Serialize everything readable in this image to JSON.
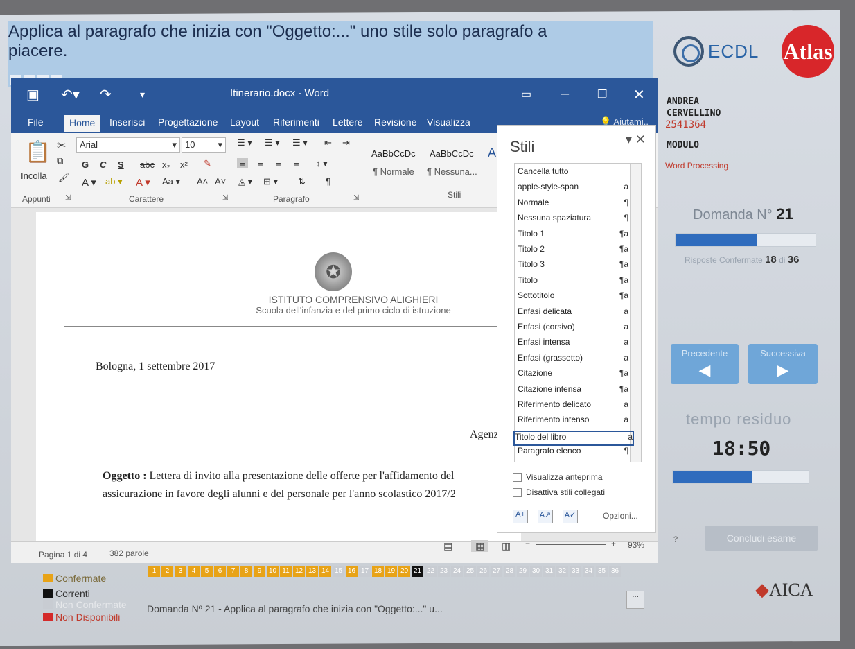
{
  "question": {
    "line1": "Applica al paragrafo che inizia con \"Oggetto:...\" uno stile solo paragrafo a",
    "line2": "piacere."
  },
  "logos": {
    "ecdl": "ECDL",
    "atlas": "Atlas",
    "aica": "AICA"
  },
  "word": {
    "title": "Itinerario.docx - Word",
    "menu": {
      "file": "File",
      "home": "Home",
      "inserisci": "Inserisci",
      "progettazione": "Progettazione",
      "layout": "Layout",
      "riferimenti": "Riferimenti",
      "lettere": "Lettere",
      "revisione": "Revisione",
      "visualizza": "Visualizza",
      "aiutami": "Aiutami.."
    },
    "ribbon": {
      "font": "Arial",
      "size": "10",
      "incolla": "Incolla",
      "style1": "AaBbCcDc",
      "style2": "AaBbCcDc",
      "style3": "A",
      "normale": "¶ Normale",
      "nessuna": "¶ Nessuna...",
      "groups": {
        "appunti": "Appunti",
        "carattere": "Carattere",
        "paragrafo": "Paragrafo",
        "stili": "Stili"
      }
    },
    "document": {
      "school": "ISTITUTO COMPRENSIVO ALIGHIERI",
      "school_sub": "Scuola dell'infanzia e del primo ciclo di istruzione",
      "date": "Bologna, 1 settembre 2017",
      "agenz": "Agenz",
      "oggetto_label": "Oggetto :",
      "oggetto_line1": " Lettera di invito alla presentazione delle offerte per l'affidamento del",
      "oggetto_line2": "assicurazione in favore degli alunni e del personale per l'anno scolastico 2017/2"
    },
    "status": {
      "page": "Pagina 1 di 4",
      "words": "382 parole",
      "zoom": "93%"
    }
  },
  "styles_pane": {
    "title": "Stili",
    "items": [
      {
        "label": "Cancella tutto",
        "sym": ""
      },
      {
        "label": "apple-style-span",
        "sym": "a"
      },
      {
        "label": "Normale",
        "sym": "¶"
      },
      {
        "label": "Nessuna spaziatura",
        "sym": "¶"
      },
      {
        "label": "Titolo 1",
        "sym": "¶a"
      },
      {
        "label": "Titolo 2",
        "sym": "¶a"
      },
      {
        "label": "Titolo 3",
        "sym": "¶a"
      },
      {
        "label": "Titolo",
        "sym": "¶a"
      },
      {
        "label": "Sottotitolo",
        "sym": "¶a"
      },
      {
        "label": "Enfasi delicata",
        "sym": "a"
      },
      {
        "label": "Enfasi (corsivo)",
        "sym": "a"
      },
      {
        "label": "Enfasi intensa",
        "sym": "a"
      },
      {
        "label": "Enfasi (grassetto)",
        "sym": "a"
      },
      {
        "label": "Citazione",
        "sym": "¶a"
      },
      {
        "label": "Citazione intensa",
        "sym": "¶a"
      },
      {
        "label": "Riferimento delicato",
        "sym": "a"
      },
      {
        "label": "Riferimento intenso",
        "sym": "a"
      },
      {
        "label": "Titolo del libro",
        "sym": "a"
      },
      {
        "label": "Paragrafo elenco",
        "sym": "¶"
      }
    ],
    "anteprima": "Visualizza anteprima",
    "disattiva": "Disattiva stili collegati",
    "opzioni": "Opzioni..."
  },
  "candidate": {
    "first": "ANDREA",
    "last": "CERVELLINO",
    "id": "2541364",
    "modulo_label": "MODULO",
    "modulo": "Word Processing"
  },
  "progress": {
    "domanda_label": "Domanda N°",
    "domanda_num": "21",
    "risposte_label": "Risposte Confermate",
    "confermate": "18",
    "di": "di",
    "totale": "36",
    "question_fraction": 0.58,
    "time_fraction": 0.58
  },
  "nav": {
    "prev": "Precedente",
    "next": "Successiva",
    "tempo": "tempo residuo",
    "clock": "18:50",
    "help": "?",
    "concludi": "Concludi esame"
  },
  "legend": {
    "confermate": "Confermate",
    "correnti": "Correnti",
    "non_confermate": "Non Confermate",
    "non_disponibili": "Non Disponibili"
  },
  "question_numbers": [
    "1",
    "2",
    "3",
    "4",
    "5",
    "6",
    "7",
    "8",
    "9",
    "10",
    "11",
    "12",
    "13",
    "14",
    "15",
    "16",
    "17",
    "18",
    "19",
    "20",
    "21",
    "22",
    "23",
    "24",
    "25",
    "26",
    "27",
    "28",
    "29",
    "30",
    "31",
    "32",
    "33",
    "34",
    "35",
    "36"
  ],
  "question_states": [
    "c",
    "c",
    "c",
    "c",
    "c",
    "c",
    "c",
    "c",
    "c",
    "c",
    "c",
    "c",
    "c",
    "c",
    "n",
    "c",
    "n",
    "c",
    "c",
    "c",
    "cur",
    "n",
    "n",
    "n",
    "n",
    "n",
    "n",
    "n",
    "n",
    "n",
    "n",
    "n",
    "n",
    "n",
    "n",
    "n"
  ],
  "bottom_question": "Domanda Nº 21 - Applica al paragrafo che inizia con \"Oggetto:...\" u...",
  "colors": {
    "word_blue": "#2b579a",
    "confermate": "#e8a317",
    "correnti": "#111111",
    "non_confermate": "#c8ccd2",
    "non_disponibili": "#d42a2a"
  }
}
